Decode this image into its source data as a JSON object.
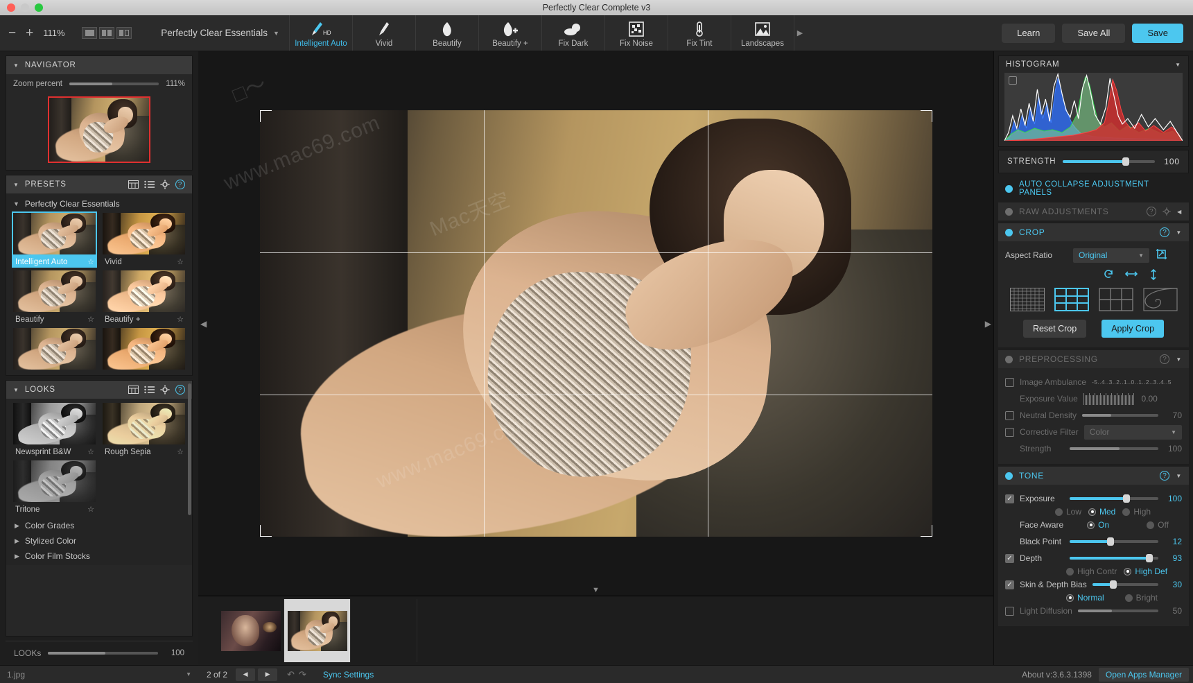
{
  "window": {
    "title": "Perfectly Clear Complete v3"
  },
  "toolbar": {
    "zoom_out": "−",
    "zoom_in": "+",
    "zoom_percent": "111%",
    "view_modes": [
      "single-view-icon",
      "compare-view-icon",
      "split-view-icon"
    ],
    "preset_name": "Perfectly Clear Essentials",
    "tools": [
      {
        "label": "Intelligent Auto",
        "icon": "brush-hd-icon",
        "active": true
      },
      {
        "label": "Vivid",
        "icon": "brush-icon",
        "active": false
      },
      {
        "label": "Beautify",
        "icon": "face-icon",
        "active": false
      },
      {
        "label": "Beautify +",
        "icon": "face-plus-icon",
        "active": false
      },
      {
        "label": "Fix Dark",
        "icon": "cloud-icon",
        "active": false
      },
      {
        "label": "Fix Noise",
        "icon": "noise-icon",
        "active": false
      },
      {
        "label": "Fix Tint",
        "icon": "thermometer-icon",
        "active": false
      },
      {
        "label": "Landscapes",
        "icon": "landscape-icon",
        "active": false
      }
    ],
    "learn": "Learn",
    "save_all": "Save All",
    "save": "Save"
  },
  "navigator": {
    "title": "NAVIGATOR",
    "zoom_label": "Zoom percent",
    "zoom_value": "111%"
  },
  "presets": {
    "title": "PRESETS",
    "group": "Perfectly Clear Essentials",
    "items": [
      {
        "label": "Intelligent Auto",
        "selected": true
      },
      {
        "label": "Vivid",
        "selected": false
      },
      {
        "label": "Beautify",
        "selected": false
      },
      {
        "label": "Beautify +",
        "selected": false
      }
    ]
  },
  "looks": {
    "title": "LOOKS",
    "items": [
      {
        "label": "Newsprint B&W"
      },
      {
        "label": "Rough Sepia"
      },
      {
        "label": "Tritone"
      }
    ],
    "groups": [
      "Color Grades",
      "Stylized Color",
      "Color Film Stocks"
    ],
    "slider_label": "LOOKs",
    "slider_value": "100"
  },
  "histogram": {
    "title": "HISTOGRAM",
    "strength_label": "STRENGTH",
    "strength_value": "100"
  },
  "panels": {
    "auto_collapse": "AUTO COLLAPSE ADJUSTMENT PANELS",
    "raw_adjustments": "RAW ADJUSTMENTS",
    "crop": {
      "title": "CROP",
      "aspect_label": "Aspect Ratio",
      "aspect_value": "Original",
      "reset": "Reset Crop",
      "apply": "Apply Crop",
      "overlay_icons": [
        "fine-grid-icon",
        "thirds-grid-icon",
        "quad-grid-icon",
        "golden-spiral-icon"
      ],
      "transform_icons": [
        "rotate-icon",
        "flip-horizontal-icon",
        "flip-vertical-icon"
      ]
    },
    "preprocessing": {
      "title": "PREPROCESSING",
      "image_ambulance": "Image Ambulance",
      "exposure_value_label": "Exposure Value",
      "exposure_scale": "-5..4..3..2..1..0..1..2..3..4..5",
      "exposure_value": "0.00",
      "neutral_density": "Neutral Density",
      "neutral_density_value": "70",
      "corrective_filter": "Corrective Filter",
      "corrective_filter_value": "Color",
      "strength": "Strength",
      "strength_value": "100"
    },
    "tone": {
      "title": "TONE",
      "exposure": "Exposure",
      "exposure_value": "100",
      "exposure_modes": [
        {
          "label": "Low",
          "on": false
        },
        {
          "label": "Med",
          "on": true
        },
        {
          "label": "High",
          "on": false
        }
      ],
      "face_aware": "Face Aware",
      "face_aware_modes": [
        {
          "label": "On",
          "on": true
        },
        {
          "label": "Off",
          "on": false
        }
      ],
      "black_point": "Black Point",
      "black_point_value": "12",
      "depth": "Depth",
      "depth_value": "93",
      "depth_modes": [
        {
          "label": "High Contr",
          "on": false
        },
        {
          "label": "High Def",
          "on": true
        }
      ],
      "skin_depth_bias": "Skin & Depth Bias",
      "skin_depth_bias_value": "30",
      "skin_modes": [
        {
          "label": "Normal",
          "on": true
        },
        {
          "label": "Bright",
          "on": false
        }
      ],
      "light_diffusion": "Light Diffusion",
      "light_diffusion_value": "50"
    }
  },
  "status": {
    "file_name": "1.jpg",
    "page_info": "2 of 2",
    "sync_settings": "Sync Settings",
    "about": "About v:3.6.3.1398",
    "open_apps_manager": "Open Apps Manager"
  },
  "watermarks": {
    "cn": "Mac天空",
    "url": "www.mac69.com"
  },
  "colors": {
    "accent": "#4cc7ef",
    "panel_bg": "#262626",
    "app_bg": "#1e1e1e",
    "crop_marker": "#e03030"
  }
}
